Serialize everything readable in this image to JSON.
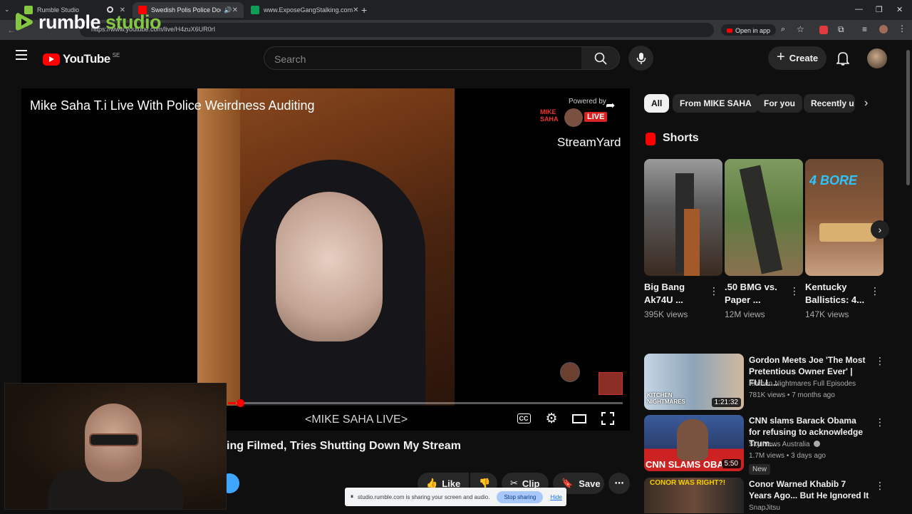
{
  "browser": {
    "tabs": [
      {
        "title": "Rumble Studio",
        "fav_color": "#85c742"
      },
      {
        "title": "Swedish Polis Police Does N",
        "fav_color": "#ff0000"
      },
      {
        "title": "www.ExposeGangStalking.com",
        "fav_color": "#0f9d58"
      }
    ],
    "new_tab_label": "+",
    "url": "https://www.youtube.com/live/H4zuX6UR0rI",
    "open_in_app": "Open in app"
  },
  "overlay": {
    "rumble_word": "rumble",
    "studio_word": "studio"
  },
  "youtube": {
    "logo_text": "YouTube",
    "region": "SE",
    "search_placeholder": "Search",
    "create_label": "Create"
  },
  "player": {
    "title": "Mike Saha T.i Live With Police Weirdness Auditing",
    "powered_by": "Powered by",
    "brand": "StreamYard",
    "badge_line1": "MIKE",
    "badge_line2": "SAHA",
    "live_badge": "LIVE",
    "caption": "<MIKE SAHA LIVE>",
    "cc_label": "CC",
    "progress": 0.02
  },
  "video": {
    "title": "ing Filmed, Tries Shutting Down My Stream",
    "like_label": "Like",
    "clip_label": "Clip",
    "save_label": "Save"
  },
  "share_banner": {
    "text": "studio.rumble.com is sharing your screen and audio.",
    "stop_label": "Stop sharing",
    "hide_label": "Hide"
  },
  "chips": [
    "All",
    "From MIKE SAHA",
    "For you",
    "Recently u"
  ],
  "shorts": {
    "heading": "Shorts",
    "items": [
      {
        "title": "Big Bang Ak74U ...",
        "views": "395K views"
      },
      {
        "title": ".50 BMG vs. Paper ...",
        "views": "12M views"
      },
      {
        "title": "Kentucky Ballistics: 4...",
        "views": "147K views",
        "overlay": "4 BORE"
      }
    ]
  },
  "recommended": [
    {
      "title": "Gordon Meets Joe 'The Most Pretentious Owner Ever' | FULL...",
      "channel": "Kitchen Nightmares Full Episodes",
      "meta": "781K views • 7 months ago",
      "duration": "1:21:32",
      "thumb_text": "KITCHEN NIGHTMARES"
    },
    {
      "title": "CNN slams Barack Obama for refusing to acknowledge Trum...",
      "channel": "Sky News Australia",
      "meta": "1.7M views • 3 days ago",
      "duration": "5:50",
      "thumb_text": "CNN SLAMS OBA",
      "badge": "New"
    },
    {
      "title": "Conor Warned Khabib 7 Years Ago... But He Ignored It",
      "channel": "SnapJitsu",
      "meta": "",
      "duration": "",
      "thumb_text": "CONOR WAS RIGHT?!"
    }
  ]
}
